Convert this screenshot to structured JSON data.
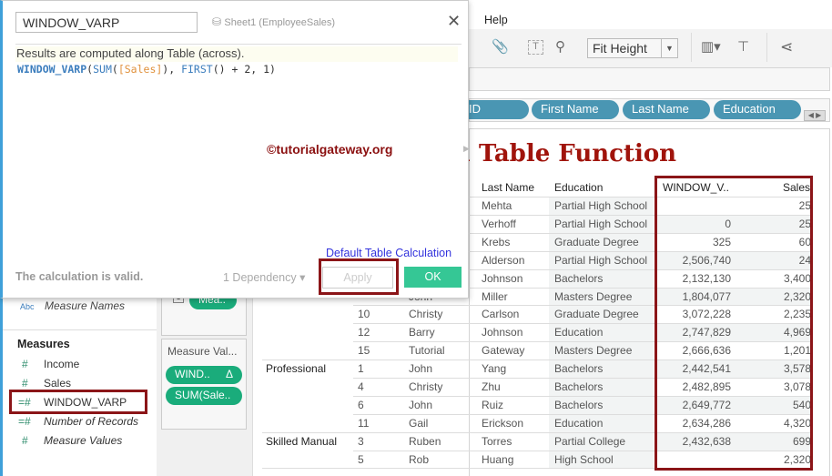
{
  "menu": {
    "help": "Help"
  },
  "toolbar": {
    "fit": "Fit Height",
    "icons": [
      "attachment-icon",
      "text-icon",
      "pin-icon",
      "show-me-icon",
      "presentation-icon",
      "share-icon"
    ]
  },
  "columns_shelf": [
    "ID",
    "First Name",
    "Last Name",
    "Education"
  ],
  "canvas_title": "u Table Function",
  "table": {
    "headers": {
      "last": "Last Name",
      "education": "Education",
      "window": "WINDOW_V..",
      "sales": "Sales"
    },
    "rows": [
      {
        "group": "",
        "id": "",
        "first": "",
        "last": "Mehta",
        "edu": "Partial High School",
        "win": "",
        "sales": "25"
      },
      {
        "group": "",
        "id": "",
        "first": "",
        "last": "Verhoff",
        "edu": "Partial High School",
        "win": "0",
        "sales": "25"
      },
      {
        "group": "",
        "id": "",
        "first": "",
        "last": "Krebs",
        "edu": "Graduate Degree",
        "win": "325",
        "sales": "60"
      },
      {
        "group": "",
        "id": "",
        "first": "",
        "last": "Alderson",
        "edu": "Partial High School",
        "win": "2,506,740",
        "sales": "24"
      },
      {
        "group": "",
        "id": "",
        "first": "",
        "last": "Johnson",
        "edu": "Bachelors",
        "win": "2,132,130",
        "sales": "3,400"
      },
      {
        "group": "",
        "id": "",
        "first": "John",
        "last": "Miller",
        "edu": "Masters Degree",
        "win": "1,804,077",
        "sales": "2,320"
      },
      {
        "group": "",
        "id": "10",
        "first": "Christy",
        "last": "Carlson",
        "edu": "Graduate Degree",
        "win": "3,072,228",
        "sales": "2,235"
      },
      {
        "group": "",
        "id": "12",
        "first": "Barry",
        "last": "Johnson",
        "edu": "Education",
        "win": "2,747,829",
        "sales": "4,969"
      },
      {
        "group": "",
        "id": "15",
        "first": "Tutorial",
        "last": "Gateway",
        "edu": "Masters Degree",
        "win": "2,666,636",
        "sales": "1,201"
      },
      {
        "group": "Professional",
        "id": "1",
        "first": "John",
        "last": "Yang",
        "edu": "Bachelors",
        "win": "2,442,541",
        "sales": "3,578"
      },
      {
        "group": "",
        "id": "4",
        "first": "Christy",
        "last": "Zhu",
        "edu": "Bachelors",
        "win": "2,482,895",
        "sales": "3,078"
      },
      {
        "group": "",
        "id": "6",
        "first": "John",
        "last": "Ruiz",
        "edu": "Bachelors",
        "win": "2,649,772",
        "sales": "540"
      },
      {
        "group": "",
        "id": "11",
        "first": "Gail",
        "last": "Erickson",
        "edu": "Education",
        "win": "2,634,286",
        "sales": "4,320"
      },
      {
        "group": "Skilled Manual",
        "id": "3",
        "first": "Ruben",
        "last": "Torres",
        "edu": "Partial College",
        "win": "2,432,638",
        "sales": "699"
      },
      {
        "group": "",
        "id": "5",
        "first": "Rob",
        "last": "Huang",
        "edu": "High School",
        "win": "",
        "sales": "2,320"
      }
    ]
  },
  "sidebar": {
    "measure_names": {
      "type": "Abc",
      "label": "Measure Names"
    },
    "measures_header": "Measures",
    "measures": [
      {
        "icon": "#",
        "label": "Income"
      },
      {
        "icon": "#",
        "label": "Sales"
      },
      {
        "icon": "=#",
        "label": "WINDOW_VARP"
      },
      {
        "icon": "=#",
        "label": "Number of Records"
      },
      {
        "icon": "#",
        "label": "Measure Values"
      }
    ]
  },
  "shelves": {
    "marks_index": "1",
    "marks_pill": "Mea..",
    "measure_values_title": "Measure Val...",
    "pills": [
      "WIND..",
      "SUM(Sale.."
    ],
    "delta": "Δ"
  },
  "dialog": {
    "name": "WINDOW_VARP",
    "source": "Sheet1 (EmployeeSales)",
    "note": "Results are computed along Table (across).",
    "formula": {
      "f1": "WINDOW_VARP",
      "p1": "(",
      "f2": "SUM",
      "p2": "(",
      "field": "[Sales]",
      "p3": "), ",
      "f3": "FIRST",
      "p4": "() + 2, 1)"
    },
    "watermark": "©tutorialgateway.org",
    "default_link": "Default Table Calculation",
    "status": "The calculation is valid.",
    "dependency": "1 Dependency ▾",
    "apply": "Apply",
    "ok": "OK",
    "close": "✕"
  },
  "colors": {
    "accent_red": "#8b1518",
    "pill_blue": "#4a96b3",
    "pill_green": "#1aac7b",
    "ok_green": "#35c795",
    "title_red": "#a0140c"
  }
}
